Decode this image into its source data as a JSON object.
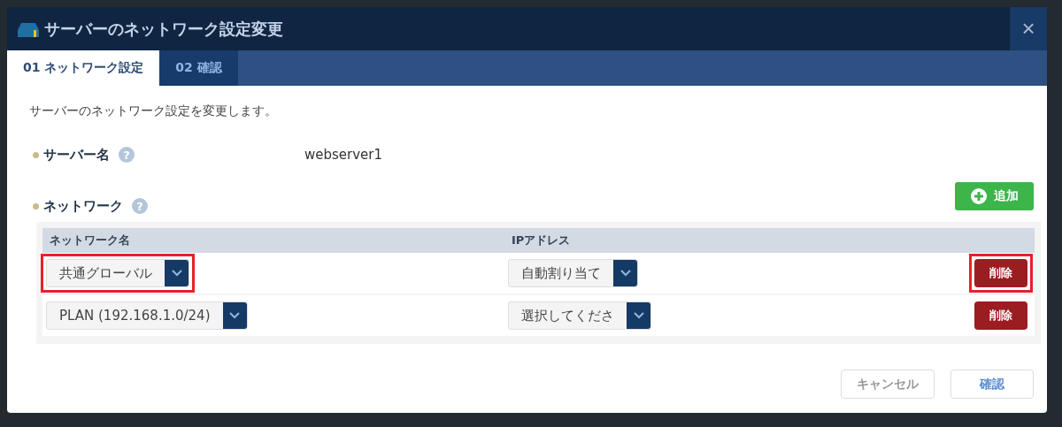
{
  "dialog": {
    "title": "サーバーのネットワーク設定変更",
    "close": "×"
  },
  "tabs": [
    {
      "label": "01 ネットワーク設定",
      "selected": true
    },
    {
      "label": "02 確認",
      "selected": false
    }
  ],
  "description": "サーバーのネットワーク設定を変更します。",
  "server_name": {
    "label": "サーバー名",
    "help": "?",
    "value": "webserver1"
  },
  "network": {
    "label": "ネットワーク",
    "help": "?",
    "add_button": "追加"
  },
  "table": {
    "columns": [
      "ネットワーク名",
      "IPアドレス"
    ],
    "rows": [
      {
        "network": {
          "value": "共通グローバル",
          "highlighted": true
        },
        "ip": {
          "value": "自動割り当て"
        },
        "delete": {
          "label": "削除",
          "highlighted": true
        }
      },
      {
        "network": {
          "value": "PLAN (192.168.1.0/24)",
          "highlighted": false
        },
        "ip": {
          "value": "選択してくださ"
        },
        "delete": {
          "label": "削除",
          "highlighted": false
        }
      }
    ]
  },
  "buttons": [
    {
      "label": "キャンセル",
      "kind": "cancel"
    },
    {
      "label": "確認",
      "kind": "confirm"
    }
  ]
}
